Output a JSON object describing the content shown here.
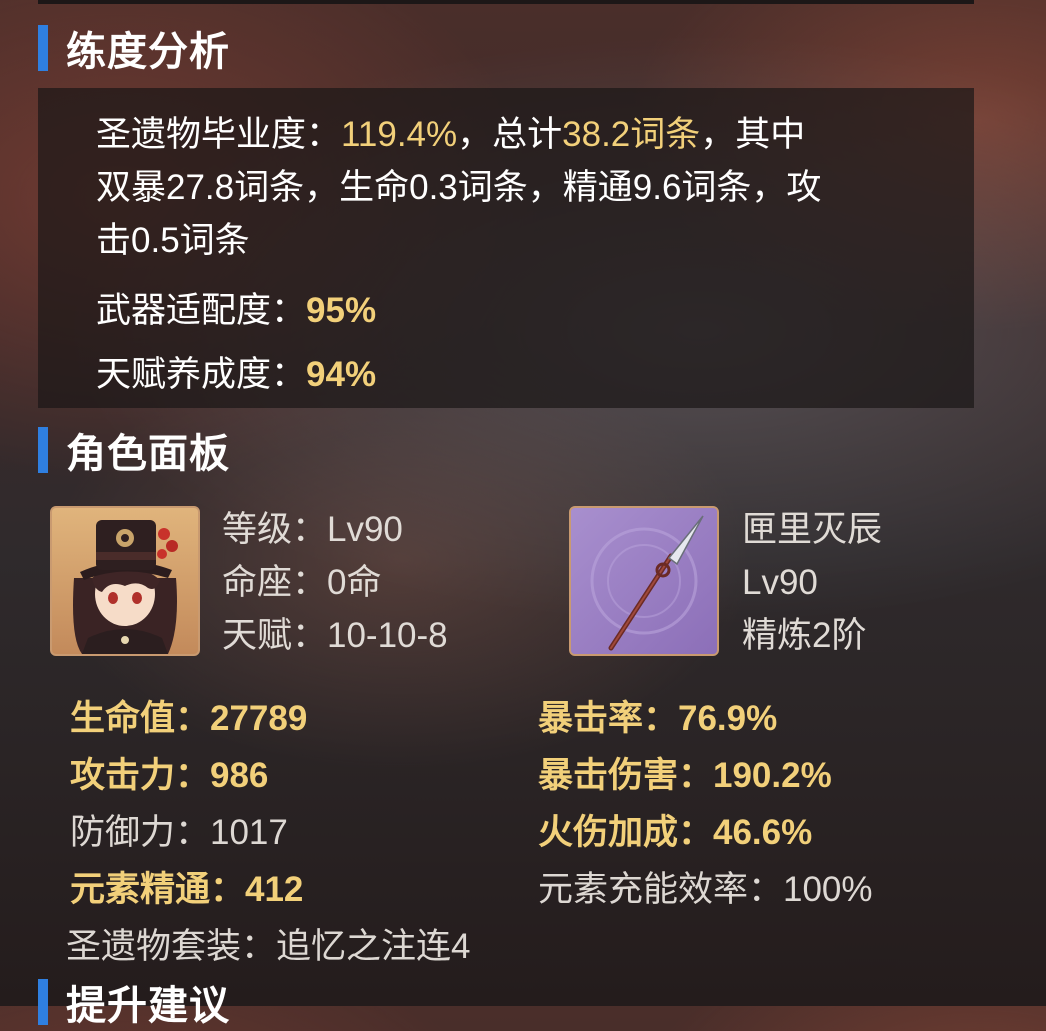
{
  "training": {
    "title": "练度分析",
    "artifact_prefix": "圣遗物毕业度：",
    "artifact_pct": "119.4%",
    "total_prefix": "，总计",
    "total_value": "38.2词条",
    "breakdown_1": "，其中",
    "breakdown_2": "双暴27.8词条，生命0.3词条，精通9.6词条，攻",
    "breakdown_3": "击0.5词条",
    "weapon_fit_label": "武器适配度：",
    "weapon_fit_value": "95%",
    "talent_label": "天赋养成度：",
    "talent_value": "94%"
  },
  "panel": {
    "title": "角色面板",
    "character": {
      "level": "等级：Lv90",
      "constellation": "命座：0命",
      "talents": "天赋：10-10-8"
    },
    "weapon": {
      "name": "匣里灭辰",
      "level": "Lv90",
      "refinement": "精炼2阶"
    },
    "stats": {
      "hp": "生命值：27789",
      "atk": "攻击力：986",
      "def": "防御力：1017",
      "em": "元素精通：412",
      "crit_rate": "暴击率：76.9%",
      "crit_dmg": "暴击伤害：190.2%",
      "pyro_bonus": "火伤加成：46.6%",
      "energy_recharge": "元素充能效率：100%",
      "artifact_set": "圣遗物套装：追忆之注连4"
    }
  },
  "next_section": {
    "title": "提升建议"
  },
  "colors": {
    "accent": "#2f7fe0",
    "highlight": "#f2d07a"
  }
}
